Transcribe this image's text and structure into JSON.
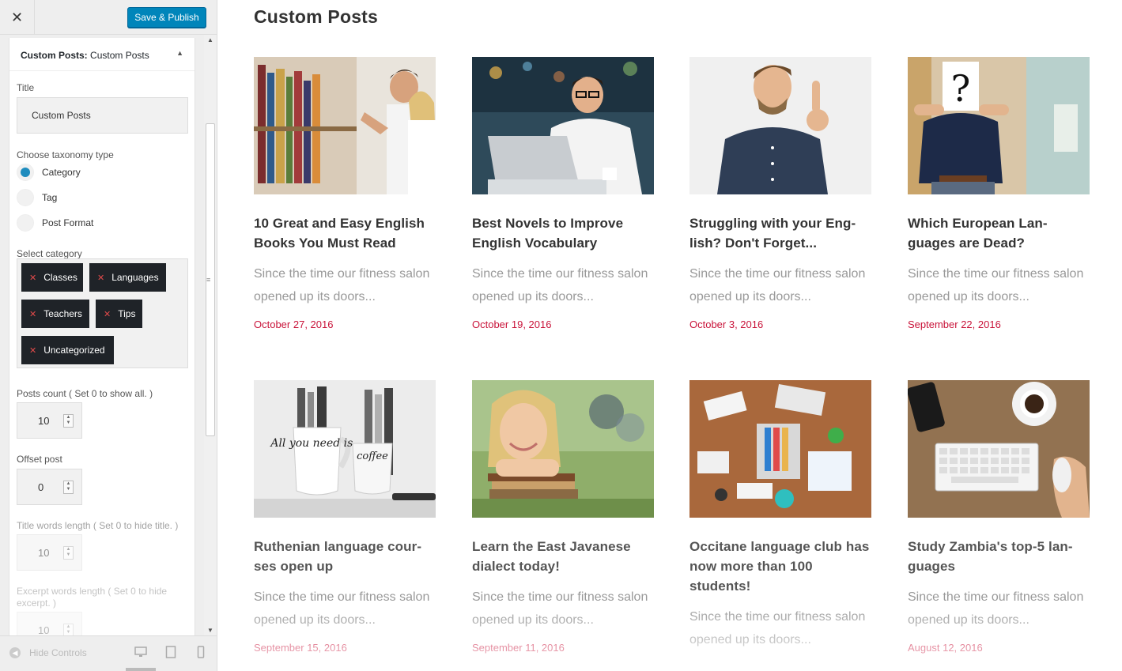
{
  "sidebar": {
    "close_label": "✕",
    "save_label": "Save & Publish",
    "section": {
      "prefix": "Custom Posts:",
      "name": "Custom Posts",
      "toggle": "▲"
    },
    "title_label": "Title",
    "title_value": "Custom Posts",
    "taxonomy_label": "Choose taxonomy type",
    "taxonomy_options": [
      {
        "label": "Category",
        "checked": true
      },
      {
        "label": "Tag",
        "checked": false
      },
      {
        "label": "Post Format",
        "checked": false
      }
    ],
    "category_label": "Select category",
    "categories": [
      "Classes",
      "Languages",
      "Teachers",
      "Tips",
      "Uncategorized"
    ],
    "posts_count_label": "Posts count ( Set 0 to show all. )",
    "posts_count_value": "10",
    "offset_label": "Offset post",
    "offset_value": "0",
    "title_words_label": "Title words length ( Set 0 to hide title. )",
    "title_words_value": "10",
    "excerpt_words_label": "Excerpt words length ( Set 0 to hide excerpt. )",
    "excerpt_words_value": "10",
    "hide_controls_label": "Hide Controls",
    "scroll_grip": "≡"
  },
  "main": {
    "title": "Custom Posts",
    "posts": [
      {
        "title": "10 Great and Easy English Books You Must Read",
        "excerpt": "Since the time our fitness salon opened up its doors...",
        "date": "October 27, 2016",
        "image": "bookstore-couple"
      },
      {
        "title": "Best Novels to Improve English Vocabulary",
        "excerpt": "Since the time our fitness salon opened up its doors...",
        "date": "October 19, 2016",
        "image": "man-laptop"
      },
      {
        "title": "Struggling with your Eng-lish? Don't Forget...",
        "excerpt": "Since the time our fitness salon opened up its doors...",
        "date": "October 3, 2016",
        "image": "man-thinking"
      },
      {
        "title": "Which European Lan-guages are Dead?",
        "excerpt": "Since the time our fitness salon opened up its doors...",
        "date": "September 22, 2016",
        "image": "question-mark-man"
      },
      {
        "title": "Ruthenian language cour-ses open up",
        "excerpt": "Since the time our fitness salon opened up its doors...",
        "date": "September 15, 2016",
        "image": "coffee-mugs"
      },
      {
        "title": "Learn the East Javanese dialect today!",
        "excerpt": "Since the time our fitness salon opened up its doors...",
        "date": "September 11, 2016",
        "image": "girl-books"
      },
      {
        "title": "Occitane language club has now more than 100 students!",
        "excerpt": "Since the time our fitness salon opened up its doors...",
        "date": "",
        "image": "team-desk"
      },
      {
        "title": "Study Zambia's top-5 lan-guages",
        "excerpt": "Since the time our fitness salon opened up its doors...",
        "date": "August 12, 2016",
        "image": "keyboard-coffee"
      }
    ],
    "mug_text_1": "All you need is...",
    "mug_text_2": "coffee"
  },
  "colors": {
    "accent": "#0085ba",
    "date": "#c9143a",
    "chip": "#1f2328",
    "radio": "#1e8cbe"
  }
}
